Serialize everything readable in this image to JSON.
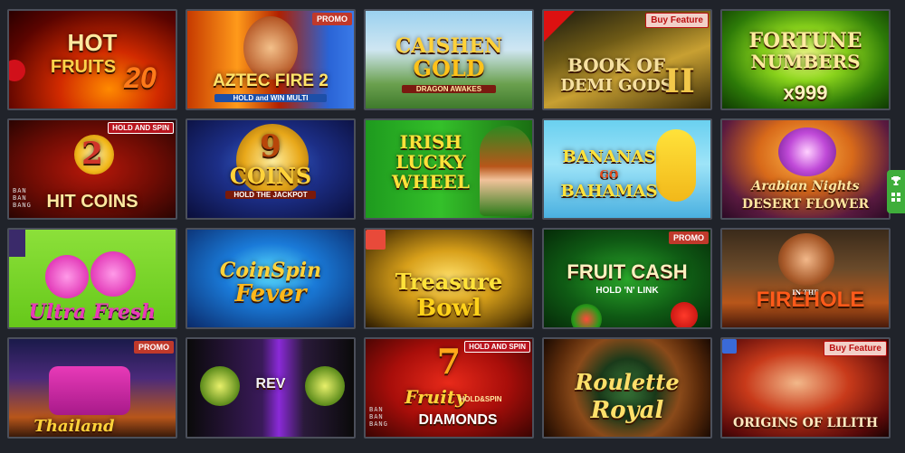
{
  "games": [
    {
      "title": "HOT FRUITS 20",
      "line1": "HOT",
      "line2": "FRUITS",
      "line3": "20",
      "badge": null
    },
    {
      "title": "AZTEC FIRE 2",
      "line1": "AZTEC FIRE 2",
      "sub": "HOLD and WIN MULTI",
      "badge": "PROMO"
    },
    {
      "title": "CAISHEN GOLD",
      "line1": "CAISHEN",
      "line2": "GOLD",
      "sub": "DRAGON AWAKES",
      "badge": null
    },
    {
      "title": "BOOK OF DEMI GODS II",
      "line1": "BOOK OF",
      "line2": "DEMI GODS",
      "line3": "II",
      "badge": "Buy Feature"
    },
    {
      "title": "FORTUNE NUMBERS",
      "line1": "FORTUNE",
      "line2": "NUMBERS",
      "sub": "x999",
      "badge": null
    },
    {
      "title": "HIT COINS 2",
      "line1": "2",
      "line2": "HIT COINS",
      "studio": [
        "BAN",
        "BAN",
        "BANG"
      ],
      "badge": "HOLD AND SPIN"
    },
    {
      "title": "9 COINS",
      "line1": "9",
      "line2": "COINS",
      "sub": "HOLD THE JACKPOT",
      "badge": null
    },
    {
      "title": "IRISH LUCKY WHEEL",
      "line1": "IRISH",
      "line2": "LUCKY",
      "line3": "WHEEL",
      "badge": null
    },
    {
      "title": "BANANAS GO BAHAMAS",
      "line1": "BANANAS",
      "line2": "GO",
      "line3": "BAHAMAS",
      "badge": null
    },
    {
      "title": "Arabian Nights Desert Flower",
      "line1": "Arabian Nights",
      "line2": "DESERT FLOWER",
      "badge": null
    },
    {
      "title": "Ultra Fresh",
      "line1": "Ultra Fresh",
      "badge": null
    },
    {
      "title": "Coin Spin Fever",
      "line1": "CoinSpin",
      "line2": "Fever",
      "badge": null
    },
    {
      "title": "Treasure Bowl",
      "line1": "Treasure",
      "line2": "Bowl",
      "badge": null
    },
    {
      "title": "FRUIT CASH",
      "line1": "FRUIT CASH",
      "sub": "HOLD 'N' LINK",
      "badge": "PROMO"
    },
    {
      "title": "FIRE IN THE HOLE",
      "line1": "FIRE",
      "line2": "IN THE",
      "line3": "HOLE",
      "badge": null
    },
    {
      "title": "Thailand",
      "line1": "Thailand",
      "badge": "PROMO"
    },
    {
      "title": "REV",
      "line1": "REV",
      "badge": null
    },
    {
      "title": "Fruity Diamonds",
      "line1": "7",
      "line2": "Fruity",
      "line3": "DIAMONDS",
      "sub": "HOLD&SPIN",
      "studio": [
        "BAN",
        "BAN",
        "BANG"
      ],
      "badge": "HOLD AND SPIN"
    },
    {
      "title": "Roulette Royal",
      "line1": "Roulette",
      "line2": "Royal",
      "badge": null
    },
    {
      "title": "ORIGINS OF LILITH",
      "line1": "ORIGINS OF LILITH",
      "badge": "Buy Feature"
    }
  ],
  "side_tab": {
    "icon": "trophy-icon"
  }
}
